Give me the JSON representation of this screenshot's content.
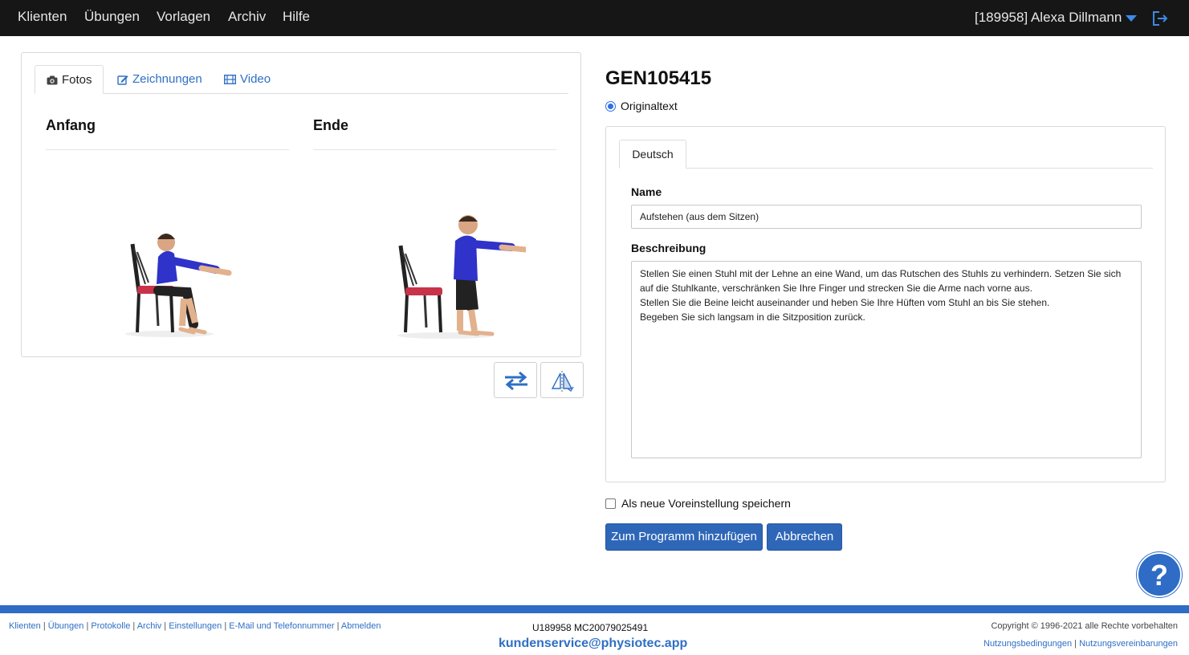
{
  "nav": {
    "items": [
      {
        "label": "Klienten"
      },
      {
        "label": "Übungen"
      },
      {
        "label": "Vorlagen"
      },
      {
        "label": "Archiv"
      },
      {
        "label": "Hilfe"
      }
    ],
    "user": "[189958] Alexa Dillmann"
  },
  "media": {
    "tabs": [
      {
        "label": "Fotos",
        "icon": "camera-icon"
      },
      {
        "label": "Zeichnungen",
        "icon": "edit-icon"
      },
      {
        "label": "Video",
        "icon": "film-icon"
      }
    ],
    "start_label": "Anfang",
    "end_label": "Ende"
  },
  "exercise": {
    "code": "GEN105415",
    "radio_label": "Originaltext",
    "lang_tab": "Deutsch",
    "name_label": "Name",
    "name_value": "Aufstehen (aus dem Sitzen)",
    "desc_label": "Beschreibung",
    "desc_value": "Stellen Sie einen Stuhl mit der Lehne an eine Wand, um das Rutschen des Stuhls zu verhindern. Setzen Sie sich auf die Stuhlkante, verschränken Sie Ihre Finger und strecken Sie die Arme nach vorne aus.\nStellen Sie die Beine leicht auseinander und heben Sie Ihre Hüften vom Stuhl an bis Sie stehen.\nBegeben Sie sich langsam in die Sitzposition zurück."
  },
  "form": {
    "save_default_label": "Als neue Voreinstellung speichern",
    "add_button": "Zum Programm hinzufügen",
    "cancel_button": "Abbrechen"
  },
  "help_label": "?",
  "footer": {
    "links": [
      "Klienten",
      "Übungen",
      "Protokolle",
      "Archiv",
      "Einstellungen",
      "E-Mail und Telefonnummer",
      "Abmelden"
    ],
    "ids": "U189958 MC20079025491",
    "email": "kundenservice@physiotec.app",
    "copyright": "Copyright © 1996-2021 alle Rechte vorbehalten",
    "terms": [
      "Nutzungsbedingungen",
      "Nutzungsvereinbarungen"
    ]
  },
  "colors": {
    "nav_bg": "#161616",
    "accent": "#2e6cc6",
    "link": "#2f6fc4"
  }
}
